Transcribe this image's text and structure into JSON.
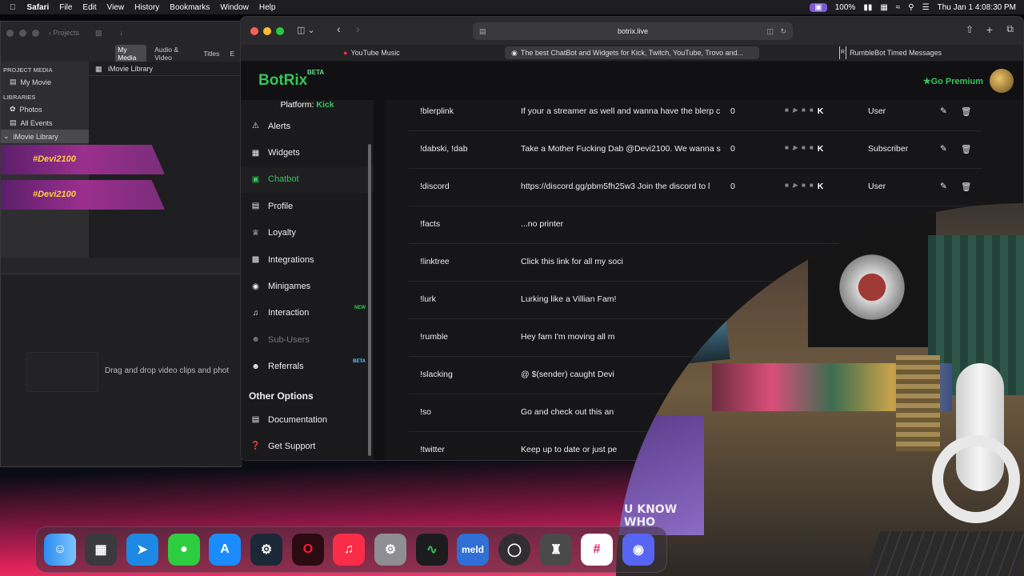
{
  "menubar": {
    "app": "Safari",
    "items": [
      "File",
      "Edit",
      "View",
      "History",
      "Bookmarks",
      "Window",
      "Help"
    ],
    "battery": "100%",
    "datetime": "Thu Jan 1  4:08:30 PM"
  },
  "imovie": {
    "projects_label": "Projects",
    "tabs": [
      "My Media",
      "Audio & Video",
      "Titles",
      "E"
    ],
    "section_project": "PROJECT MEDIA",
    "my_movie": "My Movie",
    "section_libraries": "LIBRARIES",
    "photos": "Photos",
    "all_events": "All Events",
    "library_item": "iMovie Library",
    "library_header": "iMovie Library",
    "clip1": "#Devi2100",
    "clip2": "#Devi2100",
    "timeline_hint": "Drag and drop video clips and phot"
  },
  "safari": {
    "url": "botrix.live",
    "tabs": [
      {
        "label": "YouTube Music"
      },
      {
        "label": "The best ChatBot and Widgets for Kick, Twitch, YouTube, Trovo and..."
      },
      {
        "label": "RumbleBot Timed Messages"
      }
    ]
  },
  "botrix": {
    "logo": "BotRix",
    "logo_badge": "BETA",
    "premium": "Go Premium",
    "platform_label": "Platform: ",
    "platform_value": "Kick",
    "nav": [
      {
        "label": "Alerts",
        "icon": "warning-icon"
      },
      {
        "label": "Widgets",
        "icon": "grid-icon"
      },
      {
        "label": "Chatbot",
        "icon": "robot-icon",
        "active": true
      },
      {
        "label": "Profile",
        "icon": "id-card-icon"
      },
      {
        "label": "Loyalty",
        "icon": "trophy-icon"
      },
      {
        "label": "Integrations",
        "icon": "puzzle-icon"
      },
      {
        "label": "Minigames",
        "icon": "gamepad-icon"
      },
      {
        "label": "Interaction",
        "icon": "music-icon",
        "badge": "NEW"
      },
      {
        "label": "Sub-Users",
        "icon": "users-icon",
        "dim": true
      },
      {
        "label": "Referrals",
        "icon": "user-group-icon",
        "badge": "BETA"
      }
    ],
    "other_options": "Other Options",
    "other": [
      {
        "label": "Documentation",
        "icon": "book-icon"
      },
      {
        "label": "Get Support",
        "icon": "question-icon"
      }
    ],
    "commands": [
      {
        "cmd": "!blerplink",
        "resp": "If your a streamer as well and wanna have the blerp c",
        "cooldown": "0",
        "perm": "User"
      },
      {
        "cmd": "!dabski, !dab",
        "resp": "Take a Mother Fucking Dab @Devi2100. We wanna s",
        "cooldown": "0",
        "perm": "Subscriber"
      },
      {
        "cmd": "!discord",
        "resp": "https://discord.gg/pbm5fh25w3 Join the discord to l",
        "cooldown": "0",
        "perm": "User"
      },
      {
        "cmd": "!facts",
        "resp": "...no printer"
      },
      {
        "cmd": "!linktree",
        "resp": "Click this link for all my soci"
      },
      {
        "cmd": "!lurk",
        "resp": "Lurking like a Villian Fam!"
      },
      {
        "cmd": "!rumble",
        "resp": "Hey fam I'm moving all m"
      },
      {
        "cmd": "!slacking",
        "resp": "@ $(sender) caught Devi"
      },
      {
        "cmd": "!so",
        "resp": "Go and check out this an"
      },
      {
        "cmd": "!twitter",
        "resp": "Keep up to date or just pe"
      }
    ]
  },
  "webcam": {
    "box_text": "U KNOW WHO"
  },
  "dock": [
    "finder-icon",
    "launchpad-icon",
    "safari-icon",
    "messages-icon",
    "app-store-icon",
    "steam-icon",
    "opera-icon",
    "music-icon",
    "system-settings-icon",
    "activity-monitor-icon",
    "meld-icon",
    "obs-icon",
    "tor-icon",
    "slack-icon",
    "discord-icon"
  ],
  "dock_labels": {
    "meld": "meld"
  }
}
